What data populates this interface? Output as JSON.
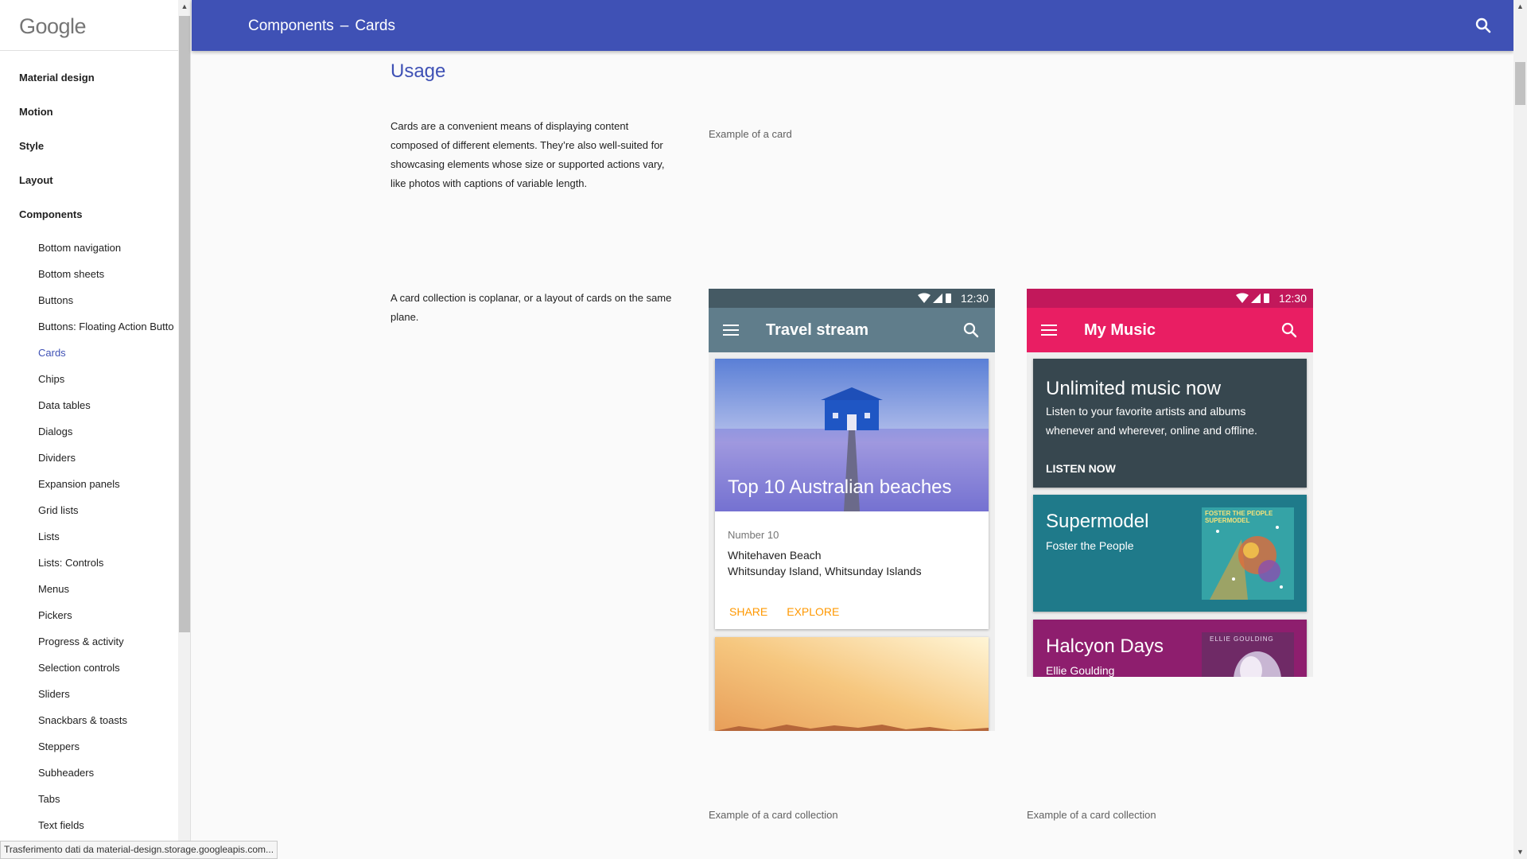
{
  "sidebar": {
    "logo": "Google",
    "sections": [
      {
        "label": "Material design"
      },
      {
        "label": "Motion"
      },
      {
        "label": "Style"
      },
      {
        "label": "Layout"
      },
      {
        "label": "Components"
      }
    ],
    "items": [
      "Bottom navigation",
      "Bottom sheets",
      "Buttons",
      "Buttons: Floating Action Butto",
      "Cards",
      "Chips",
      "Data tables",
      "Dialogs",
      "Dividers",
      "Expansion panels",
      "Grid lists",
      "Lists",
      "Lists: Controls",
      "Menus",
      "Pickers",
      "Progress & activity",
      "Selection controls",
      "Sliders",
      "Snackbars & toasts",
      "Steppers",
      "Subheaders",
      "Tabs",
      "Text fields"
    ],
    "active_item": "Cards"
  },
  "header": {
    "crumb1": "Components",
    "separator": "–",
    "crumb2": "Cards",
    "background": "#3f51b5",
    "search_icon": "search-icon"
  },
  "main": {
    "heading": "Usage",
    "para1": "Cards are a convenient means of displaying content composed of different elements. They’re also well-suited for showcasing elements whose size or supported actions vary, like photos with captions of variable length.",
    "caption1": "Example of a card",
    "para2": "A card collection is coplanar, or a layout of cards on the same plane.",
    "caption_travel": "Example of a card collection",
    "caption_music": "Example of a card collection"
  },
  "travel_phone": {
    "time": "12:30",
    "title": "Travel stream",
    "status_color": "#455a64",
    "appbar_color": "#607d8b",
    "card": {
      "image_title": "Top 10 Australian beaches",
      "kicker": "Number 10",
      "line1": "Whitehaven Beach",
      "line2": "Whitsunday Island, Whitsunday Islands",
      "action1": "SHARE",
      "action2": "EXPLORE",
      "action_color": "#ff9800"
    }
  },
  "music_phone": {
    "time": "12:30",
    "title": "My Music",
    "status_color": "#c2185b",
    "appbar_color": "#e91e63",
    "cards": [
      {
        "title": "Unlimited music now",
        "text": "Listen to your favorite artists and albums whenever and wherever, online and offline.",
        "action": "LISTEN NOW",
        "color": "#37474f"
      },
      {
        "title": "Supermodel",
        "subtitle": "Foster the People",
        "album_text": "FOSTER THE PEOPLE SUPERMODEL",
        "color": "#1f7a8a"
      },
      {
        "title": "Halcyon Days",
        "subtitle": "Ellie Goulding",
        "album_text": "ELLIE GOULDING",
        "color": "#8e1e6e"
      }
    ]
  },
  "status_tooltip": "Trasferimento dati da material-design.storage.googleapis.com..."
}
